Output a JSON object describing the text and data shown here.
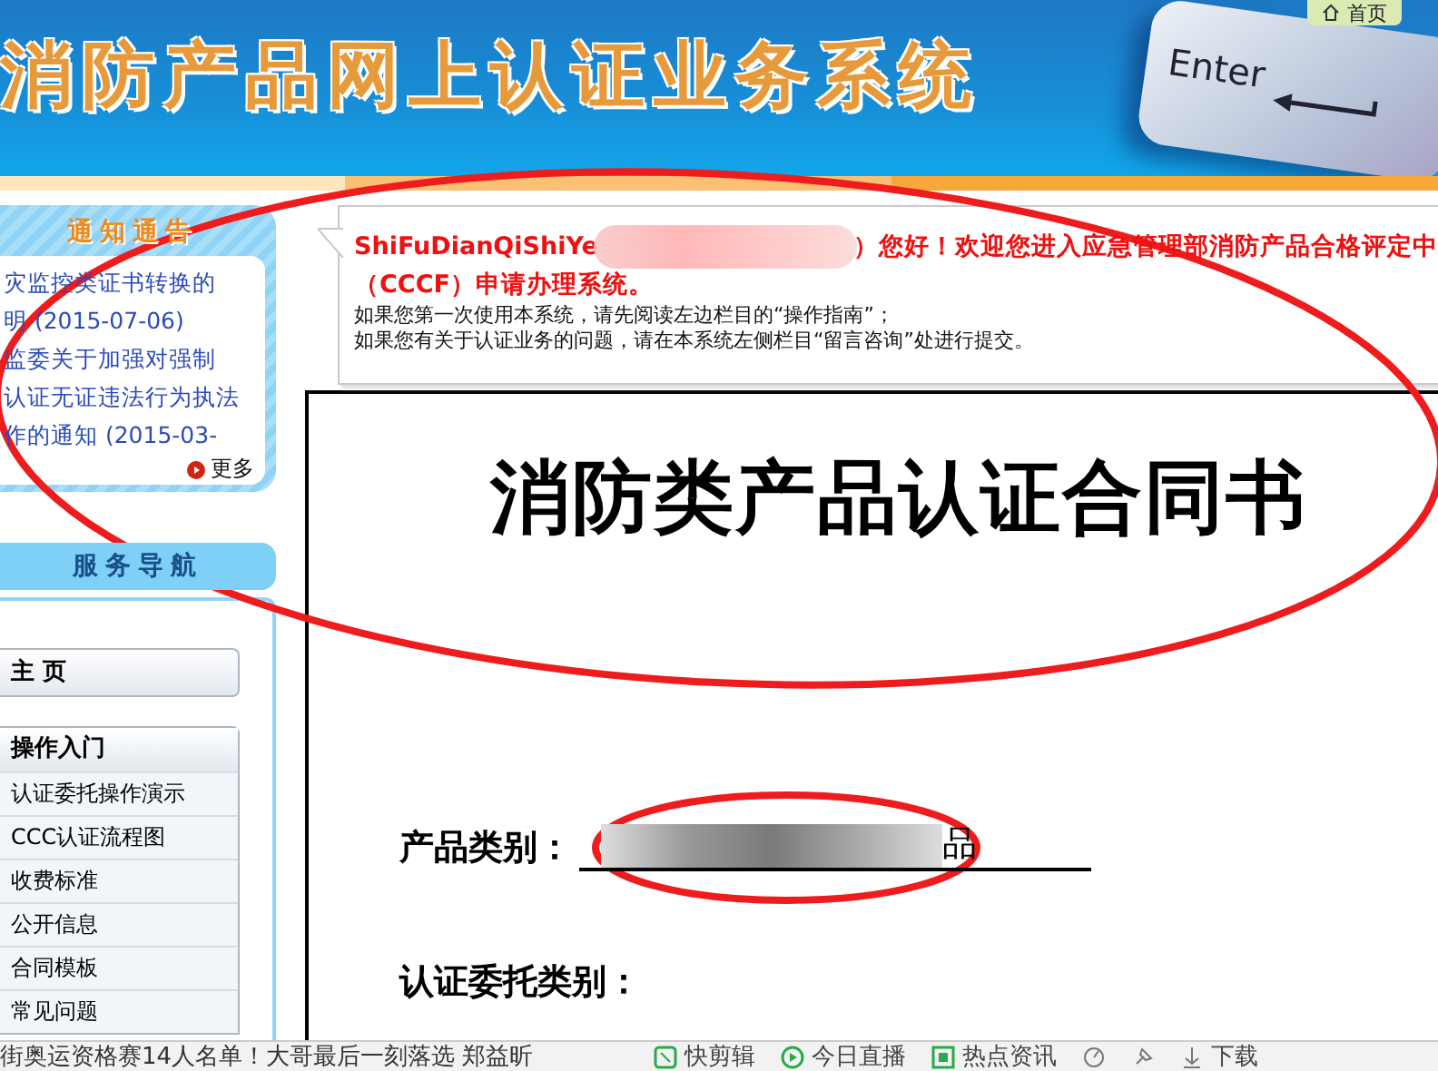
{
  "header": {
    "title": "消防产品网上认证业务系统",
    "key_label": "Enter",
    "home_link": "首页"
  },
  "notice": {
    "title": "通知通告",
    "items": [
      {
        "lines": [
          "灾监控类证书转换的",
          "明 (2015-07-06)"
        ]
      },
      {
        "lines": [
          "监委关于加强对强制",
          "认证无证违法行为执法",
          "作的通知 (2015-03-"
        ]
      }
    ],
    "more": "更多"
  },
  "nav": {
    "title": "服务导航",
    "home": "主 页",
    "section": "操作入门",
    "items": [
      "认证委托操作演示",
      "CCC认证流程图",
      "收费标准",
      "公开信息",
      "合同模板",
      "常见问题"
    ]
  },
  "greeting": {
    "name": "ShiFuDianQiShiYe",
    "welcome": "）您好！欢迎您进入应急管理部消防产品合格评定中",
    "welcome_line2": "（CCCF）申请办理系统。",
    "hints": [
      "如果您第一次使用本系统，请先阅读左边栏目的“操作指南”；",
      "如果您有关于认证业务的问题，请在本系统左侧栏目“留言咨询”处进行提交。"
    ]
  },
  "document": {
    "title": "消防类产品认证合同书",
    "fields": [
      {
        "label": "产品类别：",
        "value_tail": "品"
      },
      {
        "label": "认证委托类别："
      }
    ]
  },
  "status_bar": {
    "news": "街奥运资格赛14人名单！大哥最后一刻落选 郑益昕",
    "items": [
      "快剪辑",
      "今日直播",
      "热点资讯"
    ],
    "download": "下载"
  }
}
